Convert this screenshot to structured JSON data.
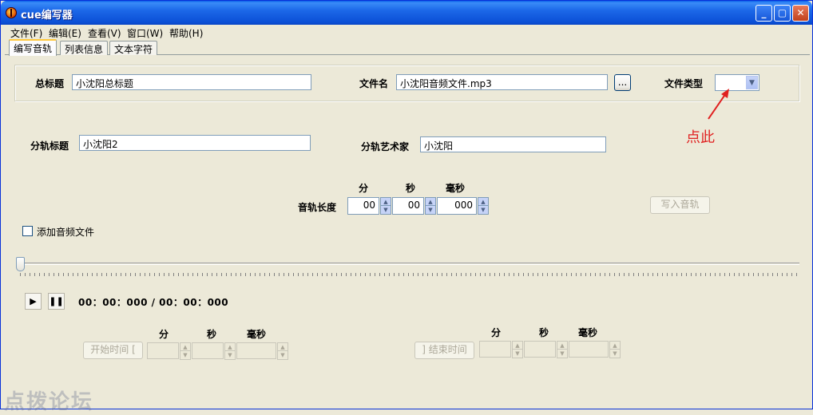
{
  "window": {
    "title": "cue编写器"
  },
  "menu": [
    {
      "label": "文件(F)"
    },
    {
      "label": "编辑(E)"
    },
    {
      "label": "查看(V)"
    },
    {
      "label": "窗口(W)"
    },
    {
      "label": "帮助(H)"
    }
  ],
  "tabs": [
    {
      "label": "编写音轨"
    },
    {
      "label": "列表信息"
    },
    {
      "label": "文本字符"
    }
  ],
  "header_group": {
    "main_title_label": "总标题",
    "main_title_value": "小沈阳总标题",
    "file_name_label": "文件名",
    "file_name_value": "小沈阳音频文件.mp3",
    "browse_label": "...",
    "file_type_label": "文件类型",
    "file_type_value": ""
  },
  "track": {
    "title_label": "分轨标题",
    "title_value": "小沈阳2",
    "artist_label": "分轨艺术家",
    "artist_value": "小沈阳",
    "length_label": "音轨长度",
    "min_header": "分",
    "sec_header": "秒",
    "ms_header": "毫秒",
    "min_value": "00",
    "sec_value": "00",
    "ms_value": "000",
    "write_button": "写入音轨"
  },
  "add_audio": {
    "label": "添加音频文件",
    "checked": false
  },
  "player": {
    "time": "00：00：000 / 00：00：000"
  },
  "start": {
    "button": "开始时间 [",
    "min_header": "分",
    "sec_header": "秒",
    "ms_header": "毫秒"
  },
  "end": {
    "button": "] 结束时间",
    "min_header": "分",
    "sec_header": "秒",
    "ms_header": "毫秒"
  },
  "annotation": {
    "text": "点此",
    "color": "#e02020"
  },
  "watermark": {
    "text": "点拨论坛"
  }
}
